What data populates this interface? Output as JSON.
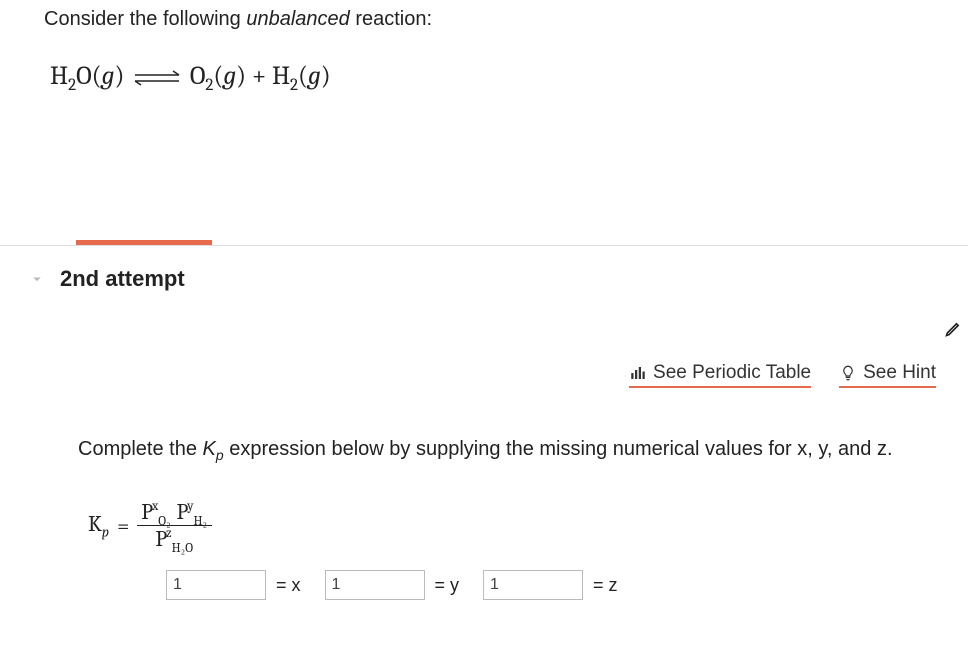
{
  "prompt": {
    "prefix": "Consider the following ",
    "emph": "unbalanced",
    "suffix": " reaction:"
  },
  "equation": {
    "lhs": "H₂O(g)",
    "rhs": "O₂(g) + H₂(g)"
  },
  "attempt": {
    "label": "2nd attempt"
  },
  "links": {
    "periodic": "See Periodic Table",
    "hint": "See Hint"
  },
  "question": {
    "prefix": "Complete the ",
    "kp": "K",
    "kp_sub": "p",
    "suffix": " expression below by supplying the missing numerical values for x, y, and z."
  },
  "kp_expr": {
    "left_base": "K",
    "left_sub": "p",
    "equals": "=",
    "num_t1_base": "P",
    "num_t1_sub": "O₂",
    "num_t1_sup": "x",
    "num_t2_base": "P",
    "num_t2_sub": "H₂",
    "num_t2_sup": "y",
    "den_t1_base": "P",
    "den_t1_sub": "H₂O",
    "den_t1_sup": "z"
  },
  "inputs": {
    "x_value": "1",
    "x_label": "= x",
    "y_value": "1",
    "y_label": "= y",
    "z_value": "1",
    "z_label": "= z"
  }
}
